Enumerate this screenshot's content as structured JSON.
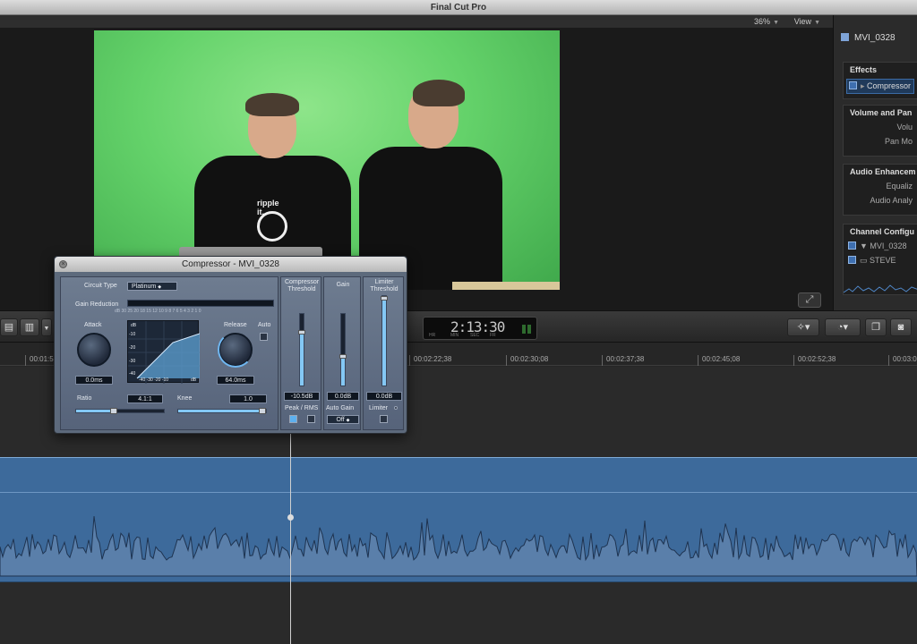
{
  "app": {
    "title": "Final Cut Pro"
  },
  "viewer": {
    "zoom": "36%",
    "view_menu": "View"
  },
  "inspector": {
    "clip_name": "MVI_0328",
    "effects_header": "Effects",
    "effects_item": "Compressor",
    "volume_header": "Volume and Pan",
    "volume_row": "Volu",
    "pan_row": "Pan Mo",
    "enhance_header": "Audio Enhancem",
    "equalize_row": "Equaliz",
    "analysis_row": "Audio Analy",
    "channel_header": "Channel Configu",
    "channel_item_1": "MVI_0328",
    "channel_item_2": "STEVE"
  },
  "toolbar": {
    "timecode": "2:13:30",
    "tc_units": [
      "HR",
      "MIN",
      "SEC",
      "FR"
    ]
  },
  "ruler": {
    "ticks": [
      "00:01:5",
      "00:02:22;38",
      "00:02:30;08",
      "00:02:37;38",
      "00:02:45;08",
      "00:02:52;38",
      "00:03:0"
    ]
  },
  "plugin": {
    "title": "Compressor - MVI_0328",
    "circuit_type_label": "Circuit Type",
    "circuit_type_value": "Platinum",
    "gain_reduction_label": "Gain Reduction",
    "gr_scale": "dB  30 25 20 18 15 12 10 9 8 7 6 5 4 3 2 1 0",
    "attack_label": "Attack",
    "attack_value": "0.0ms",
    "release_label": "Release",
    "release_value": "64.0ms",
    "auto_label": "Auto",
    "graph_db_label": "dB",
    "graph_y_ticks": [
      "-10",
      "-20",
      "-30",
      "-40"
    ],
    "graph_x_ticks": "-40 -30 -20 -10",
    "graph_x_unit": "dB",
    "ratio_label": "Ratio",
    "ratio_value": "4.1:1",
    "knee_label": "Knee",
    "knee_value": "1.0",
    "threshold_label": "Compressor Threshold",
    "threshold_value": "-10.5dB",
    "peak_rms_label": "Peak / RMS",
    "gain_label": "Gain",
    "gain_value": "0.0dB",
    "auto_gain_label": "Auto Gain",
    "auto_gain_value": "Off",
    "limiter_threshold_label": "Limiter Threshold",
    "limiter_threshold_value": "0.0dB",
    "limiter_label": "Limiter"
  },
  "colors": {
    "accent": "#84c8f5",
    "clip": "#3d6a9b",
    "green_screen": "#64d26a"
  }
}
